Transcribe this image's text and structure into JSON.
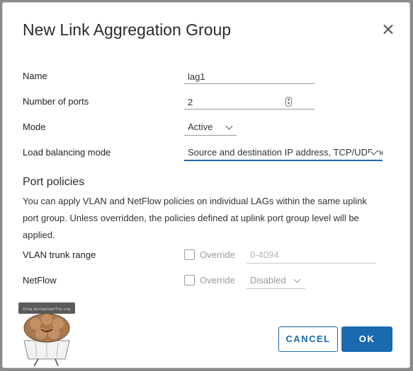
{
  "dialog": {
    "title": "New Link Aggregation Group",
    "close_icon": "close-icon"
  },
  "form": {
    "name_label": "Name",
    "name_value": "lag1",
    "ports_label": "Number of ports",
    "ports_value": "2",
    "mode_label": "Mode",
    "mode_value": "Active",
    "lb_label": "Load balancing mode",
    "lb_value": "Source and destination IP address, TCP/UDP port and VLAN"
  },
  "port_policies": {
    "title": "Port policies",
    "description": "You can apply VLAN and NetFlow policies on individual LAGs within the same uplink port group. Unless overridden, the policies defined at uplink port group level will be applied.",
    "vlan_label": "VLAN trunk range",
    "vlan_override": "Override",
    "vlan_placeholder": "0-4094",
    "netflow_label": "NetFlow",
    "netflow_override": "Override",
    "netflow_value": "Disabled"
  },
  "buttons": {
    "cancel": "CANCEL",
    "ok": "OK"
  },
  "watermark": {
    "text": "blog.minimalwaffle.org"
  },
  "colors": {
    "accent": "#1a6ab0",
    "backdrop": "#8a8a8a"
  }
}
